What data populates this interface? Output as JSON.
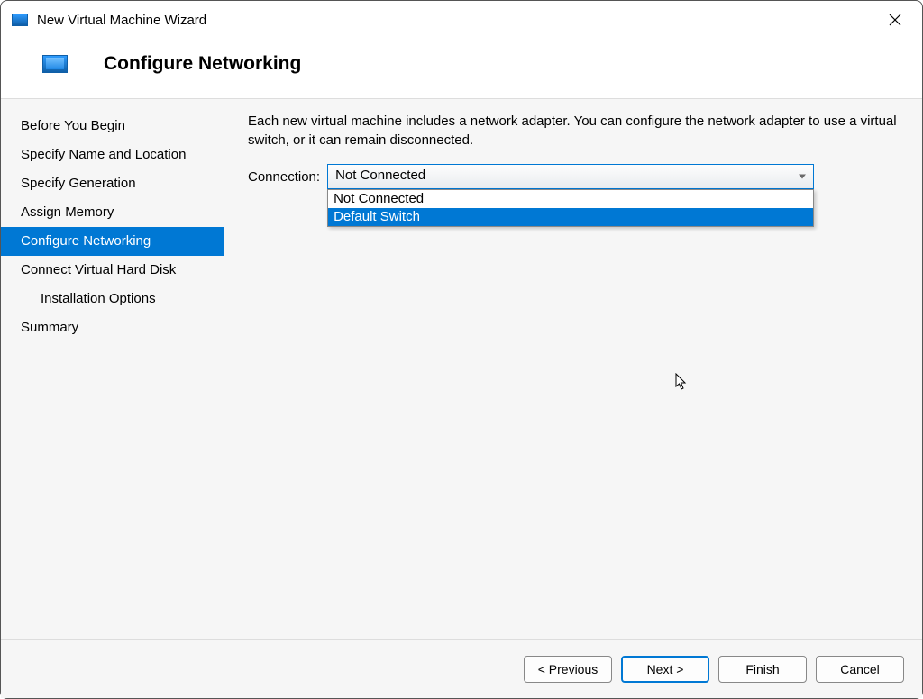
{
  "window": {
    "title": "New Virtual Machine Wizard"
  },
  "header": {
    "page_title": "Configure Networking"
  },
  "sidebar": {
    "items": [
      {
        "label": "Before You Begin"
      },
      {
        "label": "Specify Name and Location"
      },
      {
        "label": "Specify Generation"
      },
      {
        "label": "Assign Memory"
      },
      {
        "label": "Configure Networking"
      },
      {
        "label": "Connect Virtual Hard Disk"
      },
      {
        "label": "Installation Options"
      },
      {
        "label": "Summary"
      }
    ],
    "selected_index": 4
  },
  "content": {
    "description": "Each new virtual machine includes a network adapter. You can configure the network adapter to use a virtual switch, or it can remain disconnected.",
    "connection_label": "Connection:",
    "connection_value": "Not Connected",
    "options": [
      "Not Connected",
      "Default Switch"
    ],
    "highlighted_option_index": 1
  },
  "footer": {
    "previous": "< Previous",
    "next": "Next >",
    "finish": "Finish",
    "cancel": "Cancel"
  }
}
